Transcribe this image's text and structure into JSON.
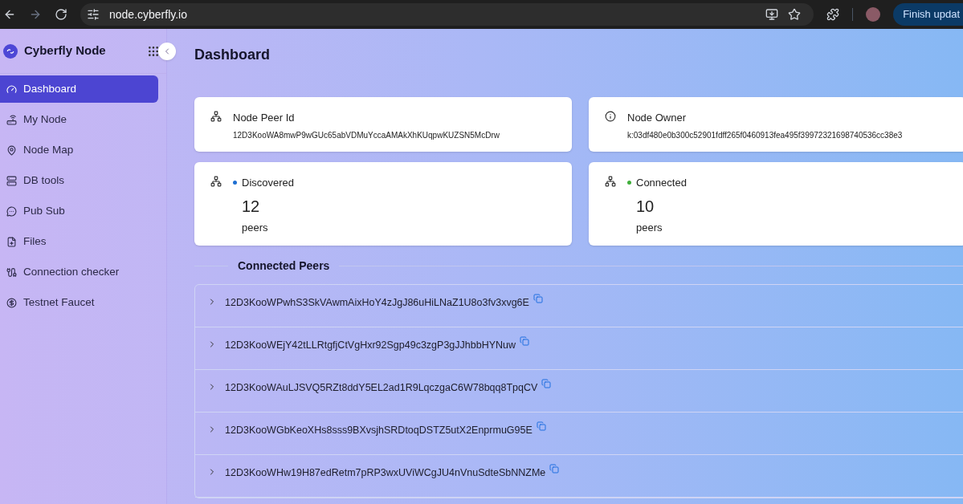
{
  "browser": {
    "url": "node.cyberfly.io",
    "update_button": "Finish updat"
  },
  "sidebar": {
    "brand": "Cyberfly Node",
    "items": [
      {
        "label": "Dashboard",
        "selected": true
      },
      {
        "label": "My Node",
        "selected": false
      },
      {
        "label": "Node Map",
        "selected": false
      },
      {
        "label": "DB tools",
        "selected": false
      },
      {
        "label": "Pub Sub",
        "selected": false
      },
      {
        "label": "Files",
        "selected": false
      },
      {
        "label": "Connection checker",
        "selected": false
      },
      {
        "label": "Testnet Faucet",
        "selected": false
      }
    ]
  },
  "page_title": "Dashboard",
  "info_cards": [
    {
      "label": "Node Peer Id",
      "value": "12D3KooWA8mwP9wGUc65abVDMuYccaAMAkXhKUqpwKUZSN5McDrw"
    },
    {
      "label": "Node Owner",
      "value": "k:03df480e0b300c52901fdff265f0460913fea495f39972321698740536cc38e3"
    }
  ],
  "stat_cards": [
    {
      "label": "Discovered",
      "color": "#1f6fd1",
      "count": "12",
      "unit": "peers"
    },
    {
      "label": "Connected",
      "color": "#3fae3a",
      "count": "10",
      "unit": "peers"
    }
  ],
  "peers_title": "Connected Peers",
  "peers": [
    {
      "id": "12D3KooWPwhS3SkVAwmAixHoY4zJgJ86uHiLNaZ1U8o3fv3xvg6E",
      "expanded": false
    },
    {
      "id": "12D3KooWEjY42tLLRtgfjCtVgHxr92Sgp49c3zgP3gJJhbbHYNuw",
      "expanded": false
    },
    {
      "id": "12D3KooWAuLJSVQ5RZt8ddY5EL2ad1R9LqczgaC6W78bqq8TpqCV",
      "expanded": false
    },
    {
      "id": "12D3KooWGbKeoXHs8sss9BXvsjhSRDtoqDSTZ5utX2EnprmuG95E",
      "expanded": false
    },
    {
      "id": "12D3KooWHw19H87edRetm7pRP3wxUViWCgJU4nVnuSdteSbNNZMe",
      "expanded": false
    }
  ]
}
